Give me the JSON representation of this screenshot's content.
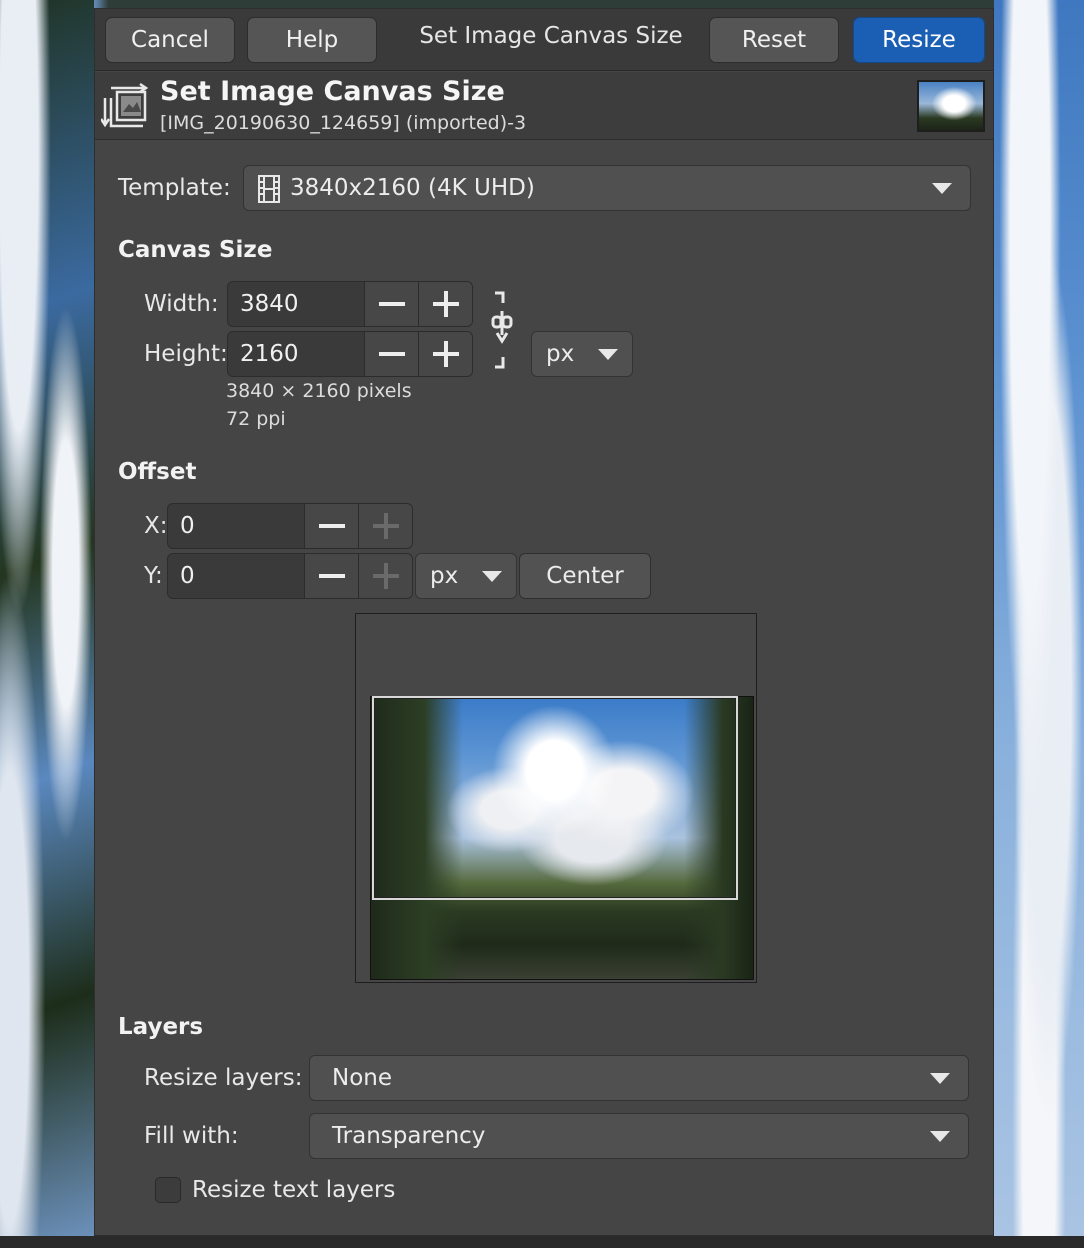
{
  "window": {
    "title": "Set Image Canvas Size",
    "buttons": {
      "cancel": "Cancel",
      "help": "Help",
      "reset": "Reset",
      "resize": "Resize"
    }
  },
  "header": {
    "title": "Set Image Canvas Size",
    "subtitle": "[IMG_20190630_124659] (imported)-3"
  },
  "template": {
    "label": "Template:",
    "value": "3840x2160 (4K UHD)"
  },
  "canvas_size": {
    "section": "Canvas Size",
    "width_label": "Width:",
    "width_value": "3840",
    "height_label": "Height:",
    "height_value": "2160",
    "unit": "px",
    "pixels_info": "3840 × 2160 pixels",
    "ppi_info": "72 ppi"
  },
  "offset": {
    "section": "Offset",
    "x_label": "X:",
    "x_value": "0",
    "y_label": "Y:",
    "y_value": "0",
    "unit": "px",
    "center_label": "Center"
  },
  "layers": {
    "section": "Layers",
    "resize_label": "Resize layers:",
    "resize_value": "None",
    "fill_label": "Fill with:",
    "fill_value": "Transparency",
    "resize_text_label": "Resize text layers",
    "resize_text_checked": false
  },
  "colors": {
    "accent": "#1a5fb4",
    "dialog_bg": "#454545"
  }
}
